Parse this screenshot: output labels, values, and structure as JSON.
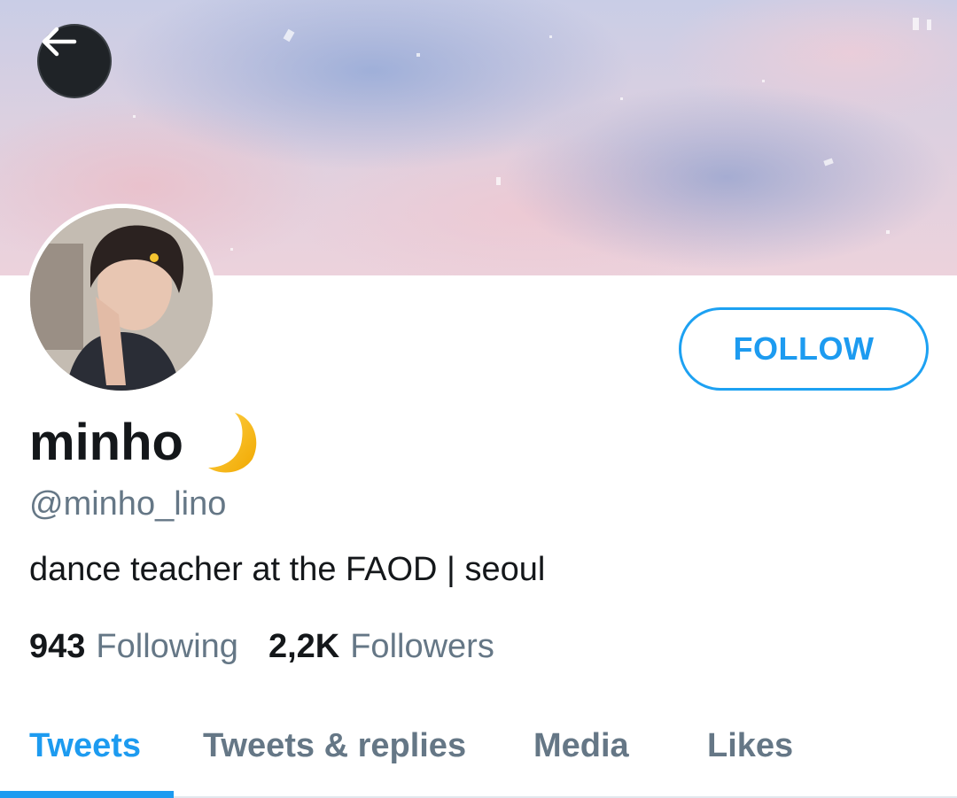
{
  "header": {
    "back_icon": "arrow-left-icon"
  },
  "profile": {
    "display_name": "minho",
    "name_emoji": "crescent-moon-icon",
    "handle": "@minho_lino",
    "bio": "dance teacher at the FAOD | seoul",
    "follow_label": "FOLLOW"
  },
  "stats": {
    "following_count": "943",
    "following_label": "Following",
    "followers_count": "2,2K",
    "followers_label": "Followers"
  },
  "tabs": [
    {
      "label": "Tweets",
      "active": true
    },
    {
      "label": "Tweets & replies",
      "active": false
    },
    {
      "label": "Media",
      "active": false
    },
    {
      "label": "Likes",
      "active": false
    }
  ],
  "colors": {
    "accent": "#1d9bf0",
    "text_primary": "#14171a",
    "text_secondary": "#657786",
    "back_button_bg": "#1f2327",
    "moon": "#f4b400"
  }
}
